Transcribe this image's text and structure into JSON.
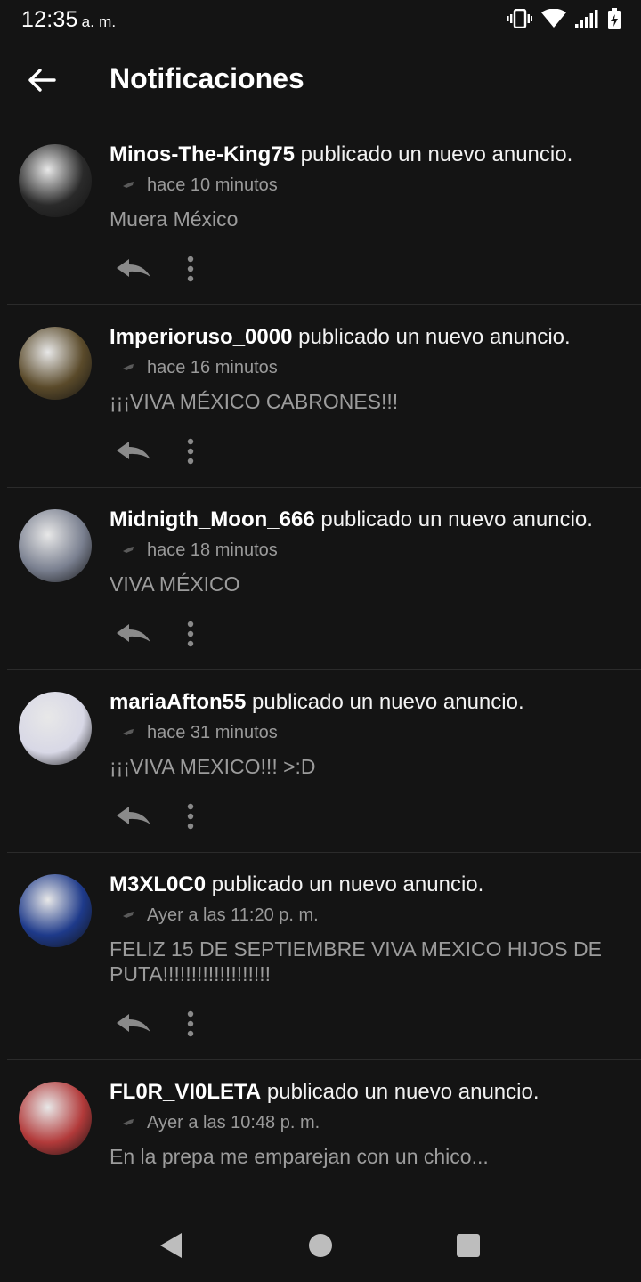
{
  "status_bar": {
    "time": "12:35",
    "ampm": "a. m."
  },
  "app_bar": {
    "title": "Notificaciones"
  },
  "notifications": [
    {
      "user": "Minos-The-King75",
      "action": "publicado un nuevo anuncio.",
      "time_ago": "hace 10 minutos",
      "message": "Muera México",
      "avatar_color": "#2a2a2a"
    },
    {
      "user": "Imperioruso_0000",
      "action": "publicado un nuevo anuncio.",
      "time_ago": "hace 16 minutos",
      "message": "¡¡¡VIVA MÉXICO CABRONES!!!",
      "avatar_color": "#5a4a2a"
    },
    {
      "user": "Midnigth_Moon_666",
      "action": "publicado un nuevo anuncio.",
      "time_ago": "hace 18 minutos",
      "message": "VIVA MÉXICO",
      "avatar_color": "#7a8090"
    },
    {
      "user": "mariaAfton55",
      "action": "publicado un nuevo anuncio.",
      "time_ago": "hace 31 minutos",
      "message": "¡¡¡VIVA MEXICO!!! >:D",
      "avatar_color": "#d8d8e6"
    },
    {
      "user": "M3XL0C0",
      "action": "publicado un nuevo anuncio.",
      "time_ago": "Ayer a las 11:20 p. m.",
      "message": "FELIZ 15 DE SEPTIEMBRE VIVA MEXICO HIJOS DE PUTA!!!!!!!!!!!!!!!!!!!",
      "avatar_color": "#1e3a8a"
    },
    {
      "user": "FL0R_VI0LETA",
      "action": "publicado un nuevo anuncio.",
      "time_ago": "Ayer a las 10:48 p. m.",
      "message": "En la prepa me emparejan con un chico...",
      "avatar_color": "#b23a3a"
    }
  ]
}
